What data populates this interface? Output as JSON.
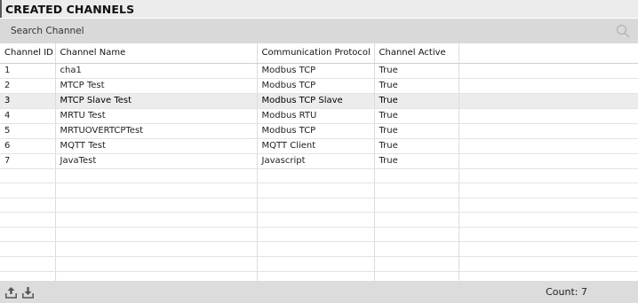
{
  "panel": {
    "title": "CREATED CHANNELS"
  },
  "search": {
    "placeholder": "Search Channel",
    "icon": "search-icon"
  },
  "table": {
    "columns": [
      "Channel ID",
      "Channel Name",
      "Communication Protocol",
      "Channel Active",
      ""
    ],
    "rows": [
      [
        "1",
        "cha1",
        "Modbus TCP",
        "True"
      ],
      [
        "2",
        "MTCP Test",
        "Modbus TCP",
        "True"
      ],
      [
        "3",
        "MTCP Slave Test",
        "Modbus TCP Slave",
        "True"
      ],
      [
        "4",
        "MRTU Test",
        "Modbus RTU",
        "True"
      ],
      [
        "5",
        "MRTUOVERTCPTest",
        "Modbus TCP",
        "True"
      ],
      [
        "6",
        "MQTT Test",
        "MQTT Client",
        "True"
      ],
      [
        "7",
        "JavaTest",
        "Javascript",
        "True"
      ]
    ],
    "selected_row_index": 2,
    "empty_rows": 8
  },
  "footer": {
    "upload_icon": "upload-icon",
    "download_icon": "download-icon",
    "count_label": "Count: 7"
  },
  "colors": {
    "title_bg": "#ececec",
    "search_bg": "#d9d9d9",
    "selected_row_bg": "#ececec",
    "footer_bg": "#dcdcdc",
    "grid_line": "#dcdcdc"
  }
}
